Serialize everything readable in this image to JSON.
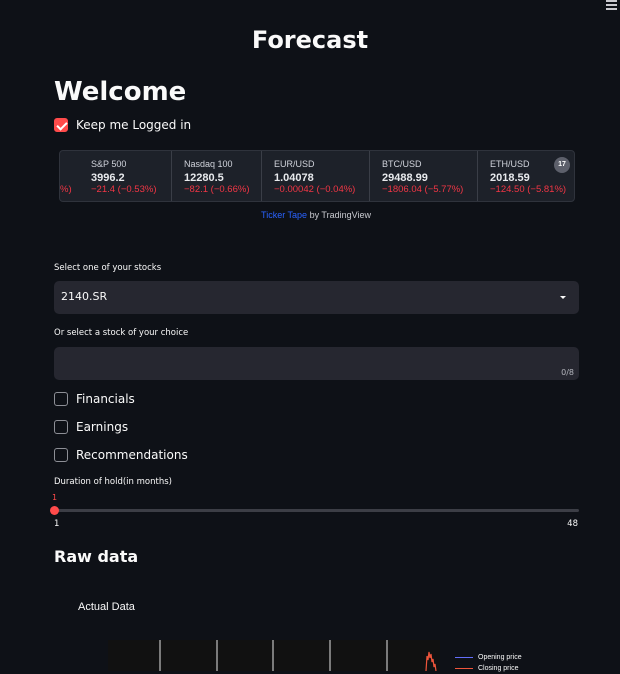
{
  "header": {
    "title": "Forecast",
    "menu_icon": "hamburger-menu-icon"
  },
  "welcome": {
    "heading": "Welcome",
    "keep_logged_in": {
      "label": "Keep me Logged in",
      "checked": true
    }
  },
  "ticker": {
    "lead_change": "%)",
    "items": [
      {
        "name": "S&P 500",
        "price": "3996.2",
        "change": "−21.4 (−0.53%)"
      },
      {
        "name": "Nasdaq 100",
        "price": "12280.5",
        "change": "−82.1 (−0.66%)"
      },
      {
        "name": "EUR/USD",
        "price": "1.04078",
        "change": "−0.00042 (−0.04%)"
      },
      {
        "name": "BTC/USD",
        "price": "29488.99",
        "change": "−1806.04 (−5.77%)"
      },
      {
        "name": "ETH/USD",
        "price": "2018.59",
        "change": "−124.50 (−5.81%)"
      }
    ],
    "logo_text": "17",
    "attribution_link": "Ticker Tape",
    "attribution_rest": " by TradingView",
    "down_color": "#f23645"
  },
  "stock_select": {
    "label": "Select one of your stocks",
    "value": "2140.SR"
  },
  "custom_stock": {
    "label": "Or select a stock of your choice",
    "value": "",
    "counter": "0/8"
  },
  "options": [
    {
      "label": "Financials",
      "checked": false
    },
    {
      "label": "Earnings",
      "checked": false
    },
    {
      "label": "Recommendations",
      "checked": false
    }
  ],
  "hold_slider": {
    "label": "Duration of hold(in months)",
    "value": "1",
    "min": "1",
    "max": "48"
  },
  "raw_data": {
    "heading": "Raw data",
    "chart_title": "Actual Data",
    "legend": [
      {
        "name": "Opening price",
        "color": "#636efa"
      },
      {
        "name": "Closing price",
        "color": "#ef553b"
      }
    ]
  },
  "accent_color": "#ff4b4b"
}
